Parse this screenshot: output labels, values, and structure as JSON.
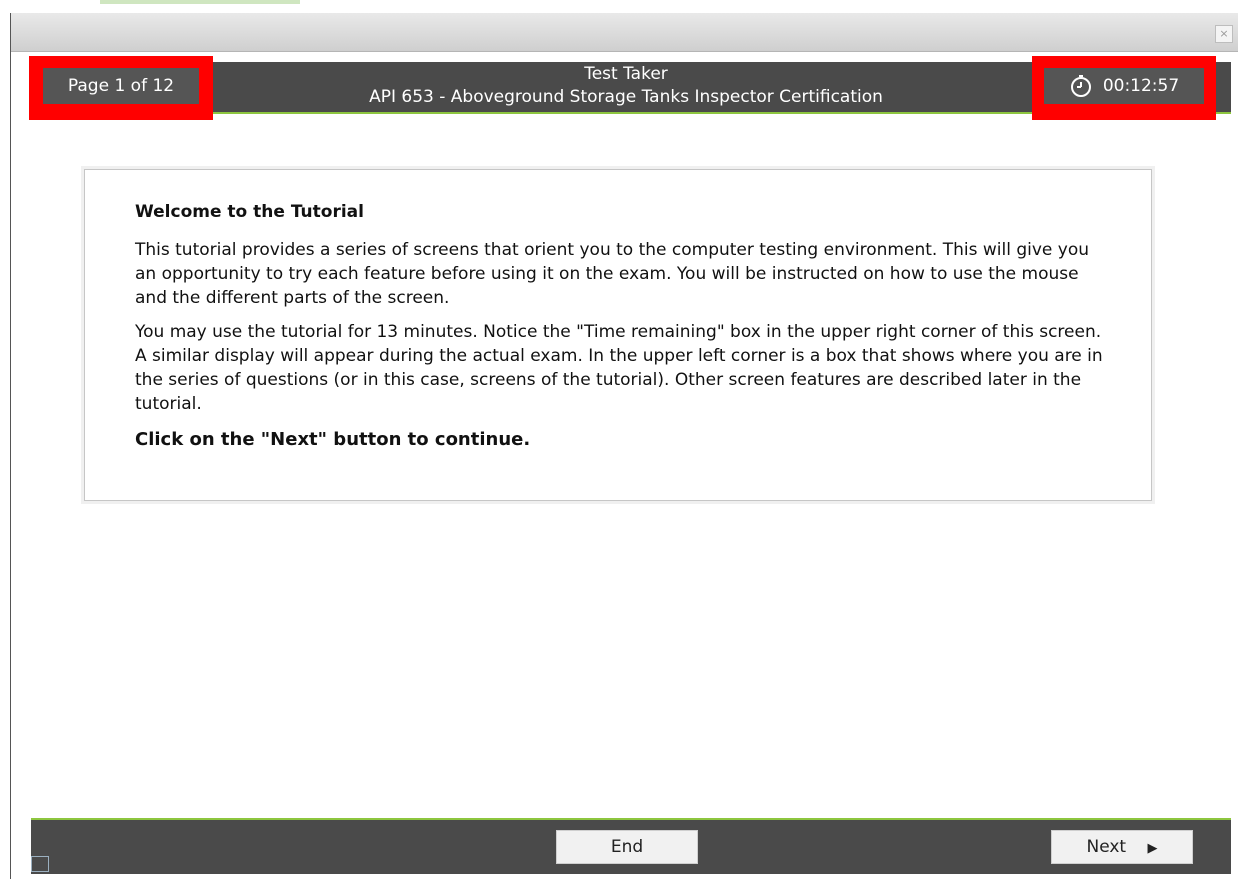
{
  "header": {
    "page_indicator": "Page 1 of 12",
    "user": "Test Taker",
    "exam_title": "API 653 - Aboveground Storage Tanks Inspector Certification",
    "timer": "00:12:57"
  },
  "titlebar": {
    "close_glyph": "×"
  },
  "content": {
    "heading": "Welcome to the Tutorial",
    "paragraph1": "This tutorial provides a series of screens that orient you to the computer testing environment. This will give you an opportunity to try each feature before using it on the exam. You will be instructed on how to use the mouse and the different parts of the screen.",
    "paragraph2": "You may use the tutorial for 13 minutes. Notice the \"Time remaining\" box in the upper right corner of this screen. A similar display will appear during the actual exam. In the upper left corner is a box that shows where you are in the series of questions (or in this case, screens of the tutorial). Other screen features are described later in the tutorial.",
    "cta": "Click on the \"Next\" button to continue."
  },
  "footer": {
    "end_label": "End",
    "next_label": "Next",
    "next_arrow": "▶"
  },
  "colors": {
    "highlight_red": "#ff0000",
    "bar_gray": "#4a4a4a",
    "accent_green": "#8dc63f"
  },
  "icons": {
    "timer": "stopwatch-icon",
    "close": "close-icon",
    "next": "play-arrow-icon"
  }
}
